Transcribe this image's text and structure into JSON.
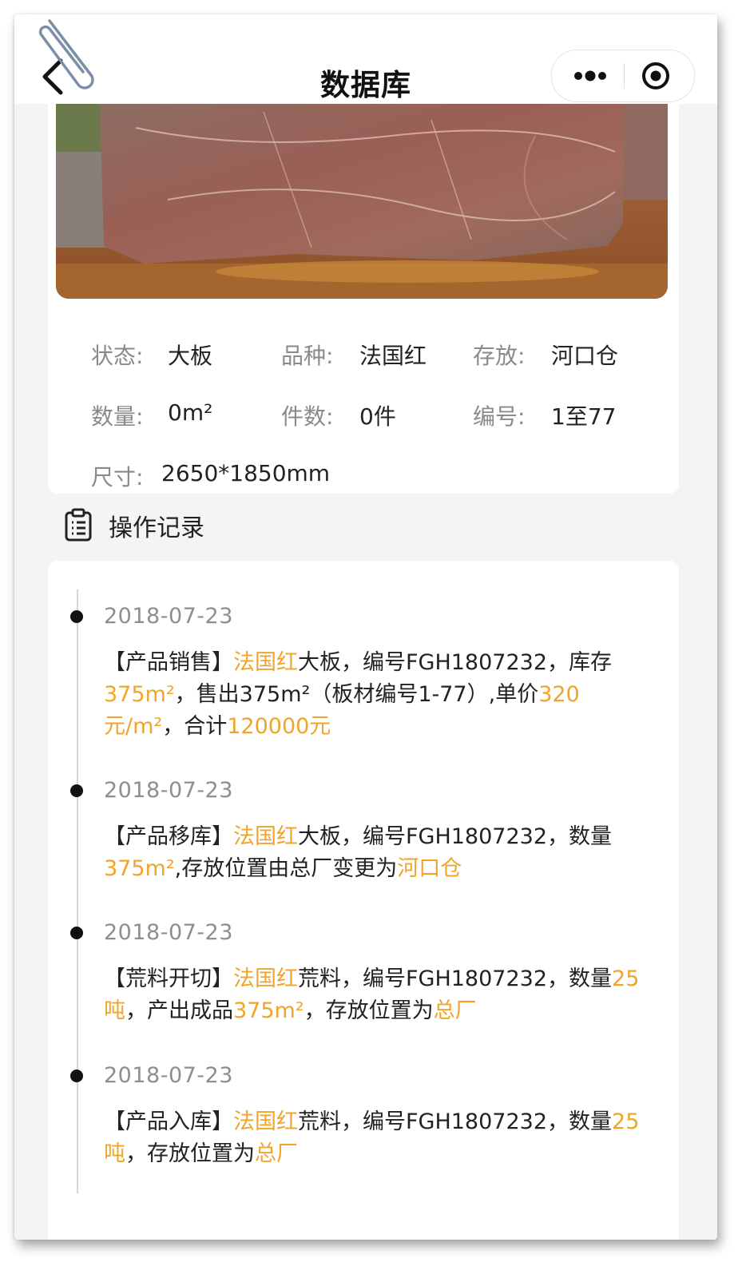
{
  "nav": {
    "title": "数据库"
  },
  "info": {
    "status_label": "状态:",
    "status_value": "大板",
    "variety_label": "品种:",
    "variety_value": "法国红",
    "storage_label": "存放:",
    "storage_value": "河口仓",
    "quantity_label": "数量:",
    "quantity_value": "0m²",
    "pieces_label": "件数:",
    "pieces_value": "0件",
    "number_label": "编号:",
    "number_value": "1至77",
    "size_label": "尺寸:",
    "size_value": "2650*1850mm"
  },
  "records": {
    "title": "操作记录",
    "items": [
      {
        "date": "2018-07-23",
        "segments": [
          {
            "t": "【产品销售】"
          },
          {
            "t": "法国红",
            "hl": true
          },
          {
            "t": "大板，编号FGH1807232，库存"
          },
          {
            "t": "375m²",
            "hl": true
          },
          {
            "t": "，售出375m²（板材编号1-77）,单价"
          },
          {
            "t": "320元/m²",
            "hl": true
          },
          {
            "t": "，合计"
          },
          {
            "t": "120000元",
            "hl": true
          }
        ]
      },
      {
        "date": "2018-07-23",
        "segments": [
          {
            "t": "【产品移库】"
          },
          {
            "t": "法国红",
            "hl": true
          },
          {
            "t": "大板，编号FGH1807232，数量"
          },
          {
            "t": "375m²",
            "hl": true
          },
          {
            "t": ",存放位置由总厂变更为"
          },
          {
            "t": "河口仓",
            "hl": true
          }
        ]
      },
      {
        "date": "2018-07-23",
        "segments": [
          {
            "t": "【荒料开切】"
          },
          {
            "t": "法国红",
            "hl": true
          },
          {
            "t": "荒料，编号FGH1807232，数量"
          },
          {
            "t": "25吨",
            "hl": true
          },
          {
            "t": "，产出成品"
          },
          {
            "t": "375m²",
            "hl": true
          },
          {
            "t": "，存放位置为"
          },
          {
            "t": "总厂",
            "hl": true
          }
        ]
      },
      {
        "date": "2018-07-23",
        "segments": [
          {
            "t": "【产品入库】"
          },
          {
            "t": "法国红",
            "hl": true
          },
          {
            "t": "荒料，编号FGH1807232，数量"
          },
          {
            "t": "25吨",
            "hl": true
          },
          {
            "t": "，存放位置为"
          },
          {
            "t": "总厂",
            "hl": true
          }
        ]
      }
    ]
  },
  "colors": {
    "highlight": "#f0a52a",
    "label_gray": "#8a8a8a",
    "page_bg": "#f4f3f6"
  }
}
